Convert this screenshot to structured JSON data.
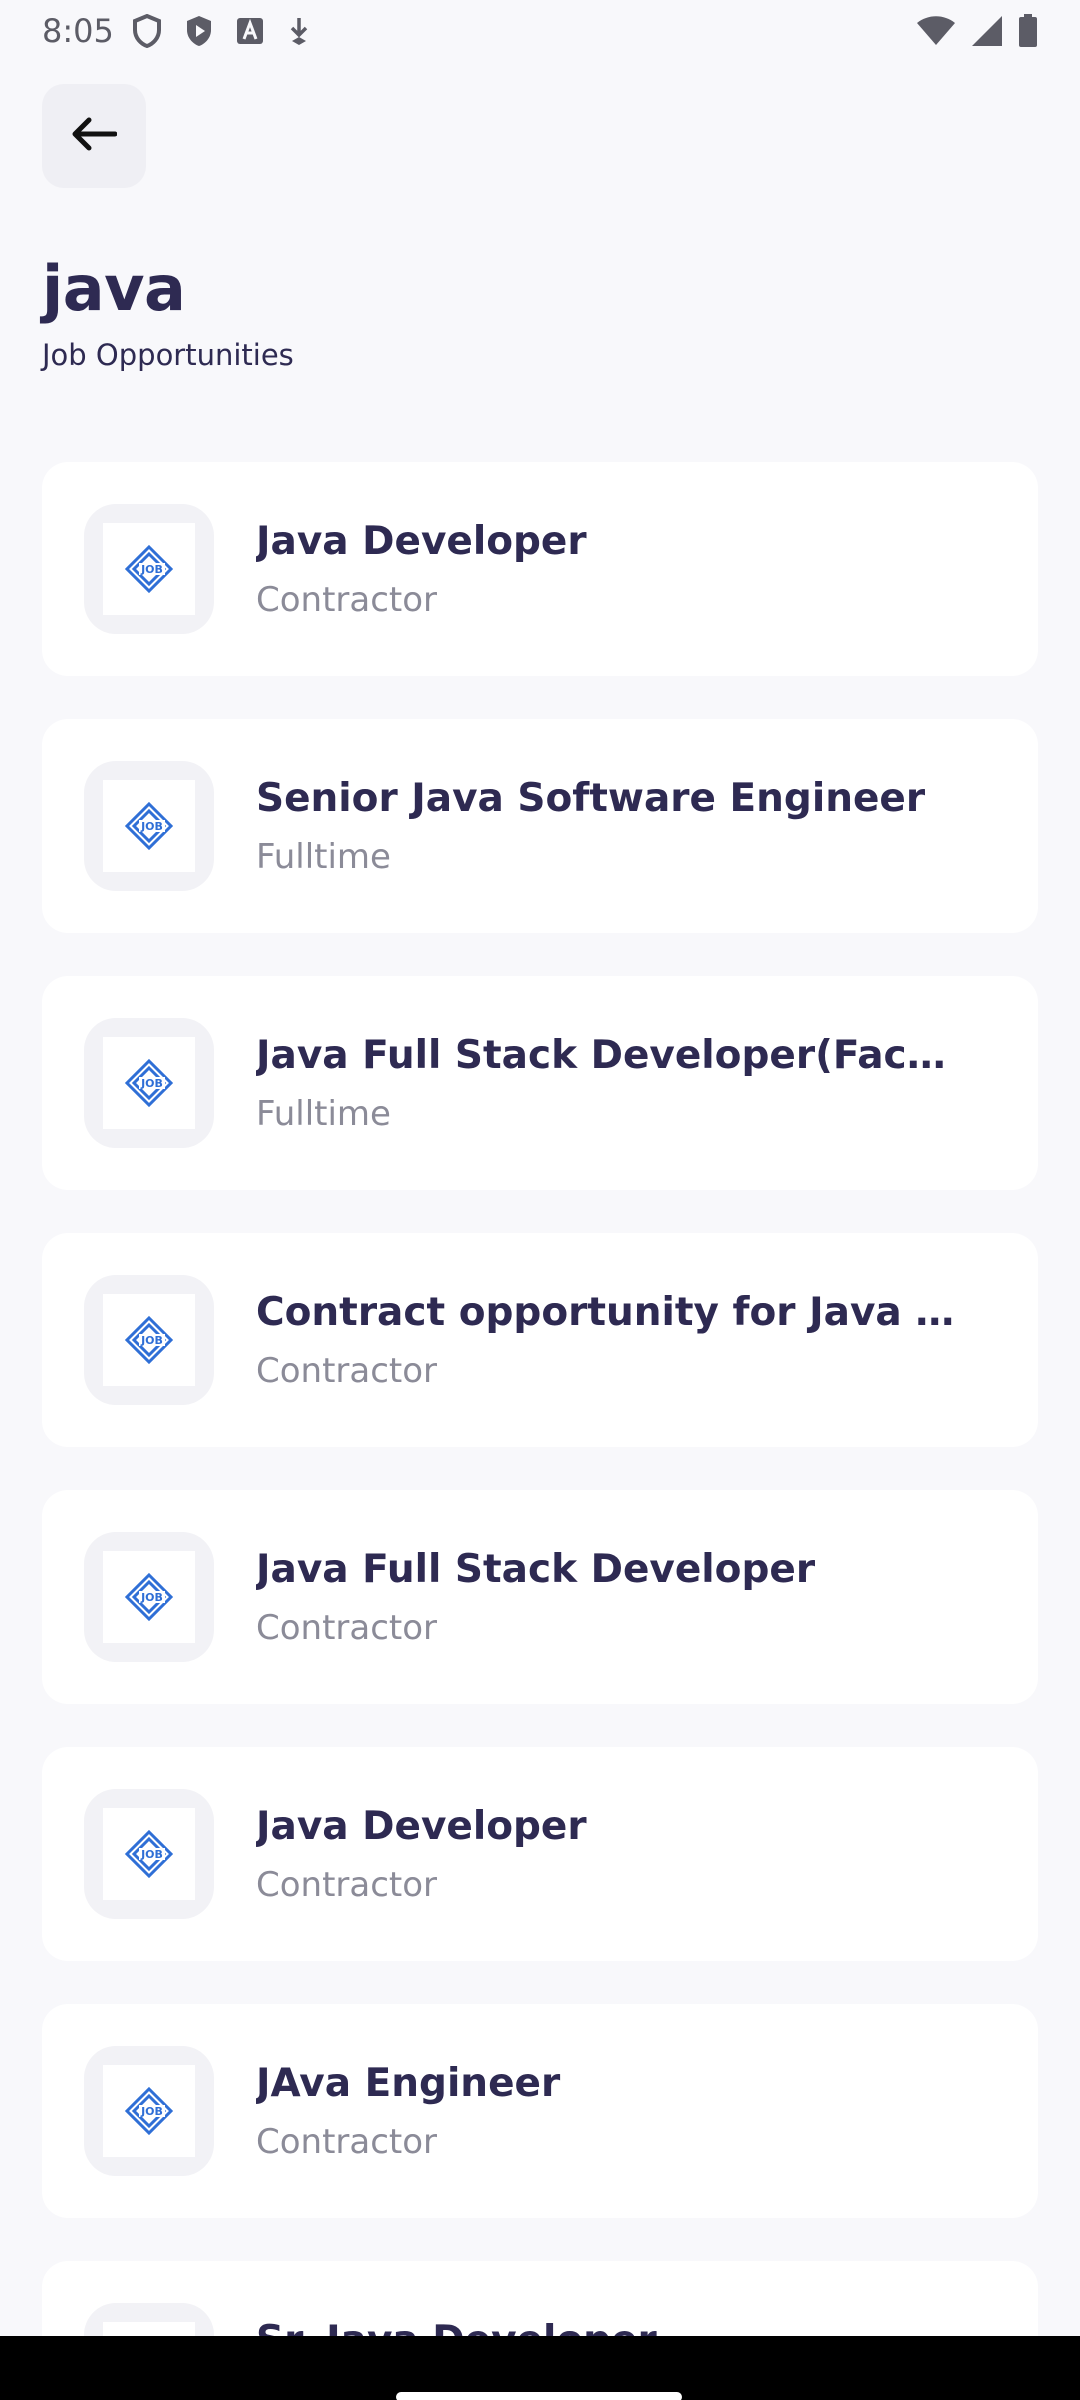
{
  "status_bar": {
    "time": "8:05",
    "icons_left": [
      "shield-icon",
      "play-shield-icon",
      "font-a-icon",
      "download-icon"
    ],
    "icons_right": [
      "wifi-icon",
      "signal-icon",
      "battery-icon"
    ]
  },
  "header": {
    "title": "java",
    "subtitle": "Job Opportunities"
  },
  "colors": {
    "background": "#f8f8fb",
    "title": "#2e2a52",
    "muted": "#8b8b98",
    "logo_blue": "#2f6fd6"
  },
  "jobs": [
    {
      "title": "Java Developer",
      "type": "Contractor"
    },
    {
      "title": "Senior Java Software Engineer",
      "type": "Fulltime"
    },
    {
      "title": "Java Full Stack Developer(Face T…",
      "type": "Fulltime"
    },
    {
      "title": "Contract opportunity for Java Fu…",
      "type": "Contractor"
    },
    {
      "title": "Java Full Stack Developer",
      "type": "Contractor"
    },
    {
      "title": "Java Developer",
      "type": "Contractor"
    },
    {
      "title": "JAva Engineer",
      "type": "Contractor"
    },
    {
      "title": "Sr. Java Developer",
      "type": "Contractor"
    }
  ],
  "logo_text": "JOB"
}
